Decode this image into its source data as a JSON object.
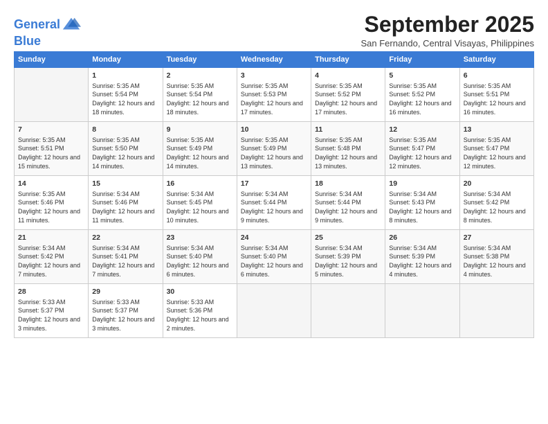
{
  "header": {
    "logo_line1": "General",
    "logo_line2": "Blue",
    "month": "September 2025",
    "location": "San Fernando, Central Visayas, Philippines"
  },
  "weekdays": [
    "Sunday",
    "Monday",
    "Tuesday",
    "Wednesday",
    "Thursday",
    "Friday",
    "Saturday"
  ],
  "weeks": [
    [
      {
        "day": "",
        "sunrise": "",
        "sunset": "",
        "daylight": ""
      },
      {
        "day": "1",
        "sunrise": "Sunrise: 5:35 AM",
        "sunset": "Sunset: 5:54 PM",
        "daylight": "Daylight: 12 hours and 18 minutes."
      },
      {
        "day": "2",
        "sunrise": "Sunrise: 5:35 AM",
        "sunset": "Sunset: 5:54 PM",
        "daylight": "Daylight: 12 hours and 18 minutes."
      },
      {
        "day": "3",
        "sunrise": "Sunrise: 5:35 AM",
        "sunset": "Sunset: 5:53 PM",
        "daylight": "Daylight: 12 hours and 17 minutes."
      },
      {
        "day": "4",
        "sunrise": "Sunrise: 5:35 AM",
        "sunset": "Sunset: 5:52 PM",
        "daylight": "Daylight: 12 hours and 17 minutes."
      },
      {
        "day": "5",
        "sunrise": "Sunrise: 5:35 AM",
        "sunset": "Sunset: 5:52 PM",
        "daylight": "Daylight: 12 hours and 16 minutes."
      },
      {
        "day": "6",
        "sunrise": "Sunrise: 5:35 AM",
        "sunset": "Sunset: 5:51 PM",
        "daylight": "Daylight: 12 hours and 16 minutes."
      }
    ],
    [
      {
        "day": "7",
        "sunrise": "Sunrise: 5:35 AM",
        "sunset": "Sunset: 5:51 PM",
        "daylight": "Daylight: 12 hours and 15 minutes."
      },
      {
        "day": "8",
        "sunrise": "Sunrise: 5:35 AM",
        "sunset": "Sunset: 5:50 PM",
        "daylight": "Daylight: 12 hours and 14 minutes."
      },
      {
        "day": "9",
        "sunrise": "Sunrise: 5:35 AM",
        "sunset": "Sunset: 5:49 PM",
        "daylight": "Daylight: 12 hours and 14 minutes."
      },
      {
        "day": "10",
        "sunrise": "Sunrise: 5:35 AM",
        "sunset": "Sunset: 5:49 PM",
        "daylight": "Daylight: 12 hours and 13 minutes."
      },
      {
        "day": "11",
        "sunrise": "Sunrise: 5:35 AM",
        "sunset": "Sunset: 5:48 PM",
        "daylight": "Daylight: 12 hours and 13 minutes."
      },
      {
        "day": "12",
        "sunrise": "Sunrise: 5:35 AM",
        "sunset": "Sunset: 5:47 PM",
        "daylight": "Daylight: 12 hours and 12 minutes."
      },
      {
        "day": "13",
        "sunrise": "Sunrise: 5:35 AM",
        "sunset": "Sunset: 5:47 PM",
        "daylight": "Daylight: 12 hours and 12 minutes."
      }
    ],
    [
      {
        "day": "14",
        "sunrise": "Sunrise: 5:35 AM",
        "sunset": "Sunset: 5:46 PM",
        "daylight": "Daylight: 12 hours and 11 minutes."
      },
      {
        "day": "15",
        "sunrise": "Sunrise: 5:34 AM",
        "sunset": "Sunset: 5:46 PM",
        "daylight": "Daylight: 12 hours and 11 minutes."
      },
      {
        "day": "16",
        "sunrise": "Sunrise: 5:34 AM",
        "sunset": "Sunset: 5:45 PM",
        "daylight": "Daylight: 12 hours and 10 minutes."
      },
      {
        "day": "17",
        "sunrise": "Sunrise: 5:34 AM",
        "sunset": "Sunset: 5:44 PM",
        "daylight": "Daylight: 12 hours and 9 minutes."
      },
      {
        "day": "18",
        "sunrise": "Sunrise: 5:34 AM",
        "sunset": "Sunset: 5:44 PM",
        "daylight": "Daylight: 12 hours and 9 minutes."
      },
      {
        "day": "19",
        "sunrise": "Sunrise: 5:34 AM",
        "sunset": "Sunset: 5:43 PM",
        "daylight": "Daylight: 12 hours and 8 minutes."
      },
      {
        "day": "20",
        "sunrise": "Sunrise: 5:34 AM",
        "sunset": "Sunset: 5:42 PM",
        "daylight": "Daylight: 12 hours and 8 minutes."
      }
    ],
    [
      {
        "day": "21",
        "sunrise": "Sunrise: 5:34 AM",
        "sunset": "Sunset: 5:42 PM",
        "daylight": "Daylight: 12 hours and 7 minutes."
      },
      {
        "day": "22",
        "sunrise": "Sunrise: 5:34 AM",
        "sunset": "Sunset: 5:41 PM",
        "daylight": "Daylight: 12 hours and 7 minutes."
      },
      {
        "day": "23",
        "sunrise": "Sunrise: 5:34 AM",
        "sunset": "Sunset: 5:40 PM",
        "daylight": "Daylight: 12 hours and 6 minutes."
      },
      {
        "day": "24",
        "sunrise": "Sunrise: 5:34 AM",
        "sunset": "Sunset: 5:40 PM",
        "daylight": "Daylight: 12 hours and 6 minutes."
      },
      {
        "day": "25",
        "sunrise": "Sunrise: 5:34 AM",
        "sunset": "Sunset: 5:39 PM",
        "daylight": "Daylight: 12 hours and 5 minutes."
      },
      {
        "day": "26",
        "sunrise": "Sunrise: 5:34 AM",
        "sunset": "Sunset: 5:39 PM",
        "daylight": "Daylight: 12 hours and 4 minutes."
      },
      {
        "day": "27",
        "sunrise": "Sunrise: 5:34 AM",
        "sunset": "Sunset: 5:38 PM",
        "daylight": "Daylight: 12 hours and 4 minutes."
      }
    ],
    [
      {
        "day": "28",
        "sunrise": "Sunrise: 5:33 AM",
        "sunset": "Sunset: 5:37 PM",
        "daylight": "Daylight: 12 hours and 3 minutes."
      },
      {
        "day": "29",
        "sunrise": "Sunrise: 5:33 AM",
        "sunset": "Sunset: 5:37 PM",
        "daylight": "Daylight: 12 hours and 3 minutes."
      },
      {
        "day": "30",
        "sunrise": "Sunrise: 5:33 AM",
        "sunset": "Sunset: 5:36 PM",
        "daylight": "Daylight: 12 hours and 2 minutes."
      },
      {
        "day": "",
        "sunrise": "",
        "sunset": "",
        "daylight": ""
      },
      {
        "day": "",
        "sunrise": "",
        "sunset": "",
        "daylight": ""
      },
      {
        "day": "",
        "sunrise": "",
        "sunset": "",
        "daylight": ""
      },
      {
        "day": "",
        "sunrise": "",
        "sunset": "",
        "daylight": ""
      }
    ]
  ]
}
